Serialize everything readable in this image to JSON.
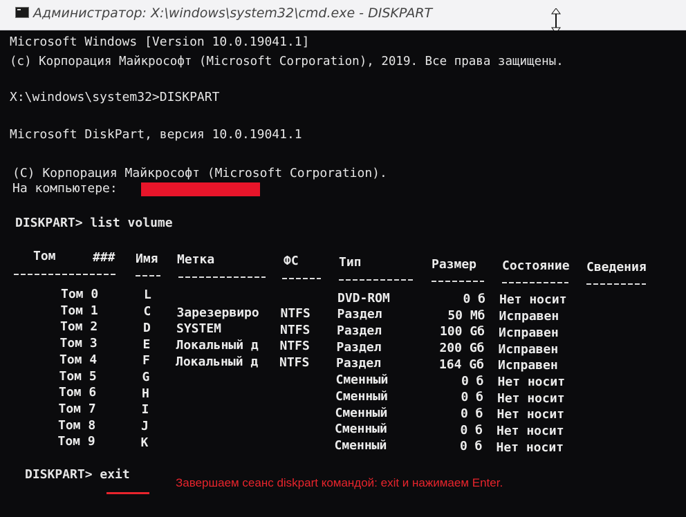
{
  "window": {
    "title": "Администратор: X:\\windows\\system32\\cmd.exe - DISKPART"
  },
  "console": {
    "lines": [
      "Microsoft Windows [Version 10.0.19041.1]",
      "(c) Корпорация Майкрософт (Microsoft Corporation), 2019. Все права защищены.",
      "X:\\windows\\system32>DISKPART",
      "Microsoft DiskPart, версия 10.0.19041.1",
      "(C) Корпорация Майкрософт (Microsoft Corporation).",
      "На компьютере:",
      "DISKPART> list volume",
      "DISKPART> exit"
    ],
    "table": {
      "headers": [
        "Том",
        "###",
        "Имя",
        "Метка",
        "ФС",
        "Тип",
        "Размер",
        "Состояние",
        "Сведения"
      ],
      "rows": [
        {
          "tom": "Том 0",
          "name": "L",
          "label": "",
          "fs": "",
          "type": "DVD-ROM",
          "size": "0 б",
          "state": "Нет носит"
        },
        {
          "tom": "Том 1",
          "name": "C",
          "label": "Зарезервиро",
          "fs": "NTFS",
          "type": "Раздел",
          "size": "50 Mб",
          "state": "Исправен"
        },
        {
          "tom": "Том 2",
          "name": "D",
          "label": "SYSTEM",
          "fs": "NTFS",
          "type": "Раздел",
          "size": "100 Gб",
          "state": "Исправен"
        },
        {
          "tom": "Том 3",
          "name": "E",
          "label": "Локальный д",
          "fs": "NTFS",
          "type": "Раздел",
          "size": "200 Gб",
          "state": "Исправен"
        },
        {
          "tom": "Том 4",
          "name": "F",
          "label": "Локальный д",
          "fs": "NTFS",
          "type": "Раздел",
          "size": "164 Gб",
          "state": "Исправен"
        },
        {
          "tom": "Том 5",
          "name": "G",
          "label": "",
          "fs": "",
          "type": "Сменный",
          "size": "0 б",
          "state": "Нет носит"
        },
        {
          "tom": "Том 6",
          "name": "H",
          "label": "",
          "fs": "",
          "type": "Сменный",
          "size": "0 б",
          "state": "Нет носит"
        },
        {
          "tom": "Том 7",
          "name": "I",
          "label": "",
          "fs": "",
          "type": "Сменный",
          "size": "0 б",
          "state": "Нет носит"
        },
        {
          "tom": "Том 8",
          "name": "J",
          "label": "",
          "fs": "",
          "type": "Сменный",
          "size": "0 б",
          "state": "Нет носит"
        },
        {
          "tom": "Том 9",
          "name": "K",
          "label": "",
          "fs": "",
          "type": "Сменный",
          "size": "0 б",
          "state": "Нет носит"
        }
      ]
    }
  },
  "annotation": {
    "text": "Завершаем сеанс diskpart командой: exit и нажимаем Enter.",
    "color": "#e8242c"
  },
  "redaction_color": "#e8152a"
}
